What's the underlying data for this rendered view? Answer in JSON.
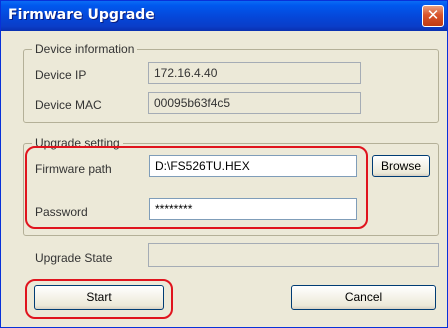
{
  "window": {
    "title": "Firmware Upgrade",
    "close_glyph": "✕"
  },
  "device_info": {
    "legend": "Device information",
    "ip_label": "Device IP",
    "ip_value": "172.16.4.40",
    "mac_label": "Device MAC",
    "mac_value": "00095b63f4c5"
  },
  "upgrade_setting": {
    "legend": "Upgrade setting",
    "firmware_path_label": "Firmware path",
    "firmware_path_value": "D:\\FS526TU.HEX",
    "browse_label": "Browse",
    "password_label": "Password",
    "password_value": "********"
  },
  "upgrade_state": {
    "label": "Upgrade State",
    "value": ""
  },
  "buttons": {
    "start": "Start",
    "cancel": "Cancel"
  },
  "colors": {
    "highlight": "#e0141e",
    "title_bar": "#0546d8",
    "dialog_bg": "#ece9d8"
  }
}
